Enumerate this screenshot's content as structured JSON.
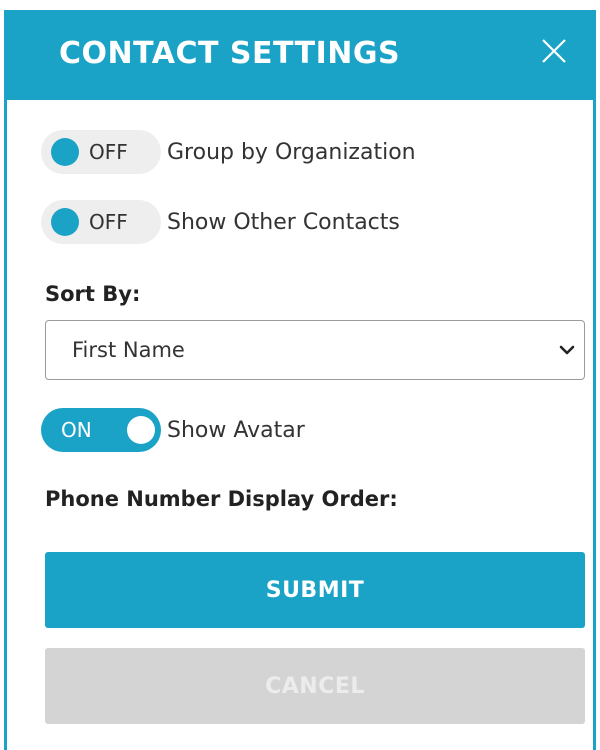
{
  "header": {
    "title": "CONTACT SETTINGS",
    "close_icon": "close-icon"
  },
  "settings": {
    "group_by_org": {
      "state": "OFF",
      "label": "Group by Organization"
    },
    "show_other_contacts": {
      "state": "OFF",
      "label": "Show Other Contacts"
    },
    "sort_by": {
      "label": "Sort By:",
      "selected": "First Name"
    },
    "show_avatar": {
      "state": "ON",
      "label": "Show Avatar"
    },
    "phone_order": {
      "label": "Phone Number Display Order:"
    }
  },
  "actions": {
    "submit_label": "SUBMIT",
    "cancel_label": "CANCEL"
  },
  "colors": {
    "accent": "#1aa3c6",
    "toggle_off_bg": "#eeeeee",
    "cancel_bg": "#d4d4d4"
  }
}
